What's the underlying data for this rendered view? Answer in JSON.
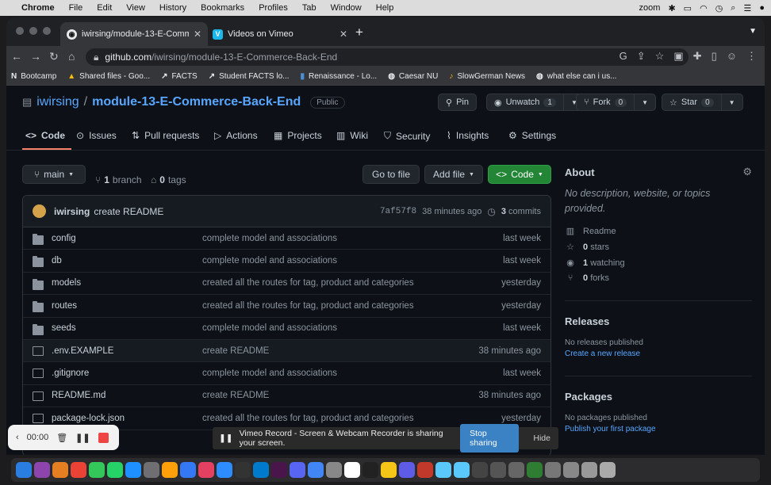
{
  "menubar": {
    "apple": "",
    "app": "Chrome",
    "items": [
      "File",
      "Edit",
      "View",
      "History",
      "Bookmarks",
      "Profiles",
      "Tab",
      "Window",
      "Help"
    ],
    "zoom": "zoom"
  },
  "tabs": [
    {
      "title": "iwirsing/module-13-E-Commerce",
      "favicon": "github-icon"
    },
    {
      "title": "Videos on Vimeo",
      "favicon": "vimeo-icon"
    }
  ],
  "address": {
    "host": "github.com",
    "path": "/iwirsing/module-13-E-Commerce-Back-End"
  },
  "bookmarks": [
    "Bootcamp",
    "Shared files - Goo...",
    "FACTS",
    "Student FACTS lo...",
    "Renaissance - Lo...",
    "Caesar NU",
    "SlowGerman News",
    "what else can i us..."
  ],
  "repo": {
    "owner": "iwirsing",
    "slash": "/",
    "name": "module-13-E-Commerce-Back-End",
    "visibility": "Public",
    "pin": "Pin",
    "unwatch": "Unwatch",
    "watch_count": "1",
    "fork": "Fork",
    "fork_count": "0",
    "star": "Star",
    "star_count": "0"
  },
  "nav": [
    "Code",
    "Issues",
    "Pull requests",
    "Actions",
    "Projects",
    "Wiki",
    "Security",
    "Insights",
    "Settings"
  ],
  "toolbar": {
    "branch": "main",
    "branches_count": "1",
    "branches_label": "branch",
    "tags_count": "0",
    "tags_label": "tags",
    "go_to_file": "Go to file",
    "add_file": "Add file",
    "code": "Code"
  },
  "commit": {
    "author": "iwirsing",
    "message": "create README",
    "sha": "7af57f8",
    "time": "38 minutes ago",
    "commits_count": "3",
    "commits_label": "commits"
  },
  "files": [
    {
      "name": "config",
      "type": "dir",
      "commit": "complete model and associations",
      "time": "last week"
    },
    {
      "name": "db",
      "type": "dir",
      "commit": "complete model and associations",
      "time": "last week"
    },
    {
      "name": "models",
      "type": "dir",
      "commit": "created all the routes for tag, product and categories",
      "time": "yesterday"
    },
    {
      "name": "routes",
      "type": "dir",
      "commit": "created all the routes for tag, product and categories",
      "time": "yesterday"
    },
    {
      "name": "seeds",
      "type": "dir",
      "commit": "complete model and associations",
      "time": "last week"
    },
    {
      "name": ".env.EXAMPLE",
      "type": "file",
      "commit": "create README",
      "time": "38 minutes ago"
    },
    {
      "name": ".gitignore",
      "type": "file",
      "commit": "complete model and associations",
      "time": "last week"
    },
    {
      "name": "README.md",
      "type": "file",
      "commit": "create README",
      "time": "38 minutes ago"
    },
    {
      "name": "package-lock.json",
      "type": "file",
      "commit": "created all the routes for tag, product and categories",
      "time": "yesterday"
    }
  ],
  "about": {
    "title": "About",
    "description": "No description, website, or topics provided.",
    "readme": "Readme",
    "stars_count": "0",
    "stars_label": "stars",
    "watching_count": "1",
    "watching_label": "watching",
    "forks_count": "0",
    "forks_label": "forks"
  },
  "releases": {
    "title": "Releases",
    "none": "No releases published",
    "create": "Create a new release"
  },
  "packages": {
    "title": "Packages",
    "none": "No packages published",
    "publish": "Publish your first package"
  },
  "recorder": {
    "time": "00:00"
  },
  "share": {
    "message": "Vimeo Record - Screen & Webcam Recorder is sharing your screen.",
    "stop": "Stop sharing",
    "hide": "Hide"
  }
}
